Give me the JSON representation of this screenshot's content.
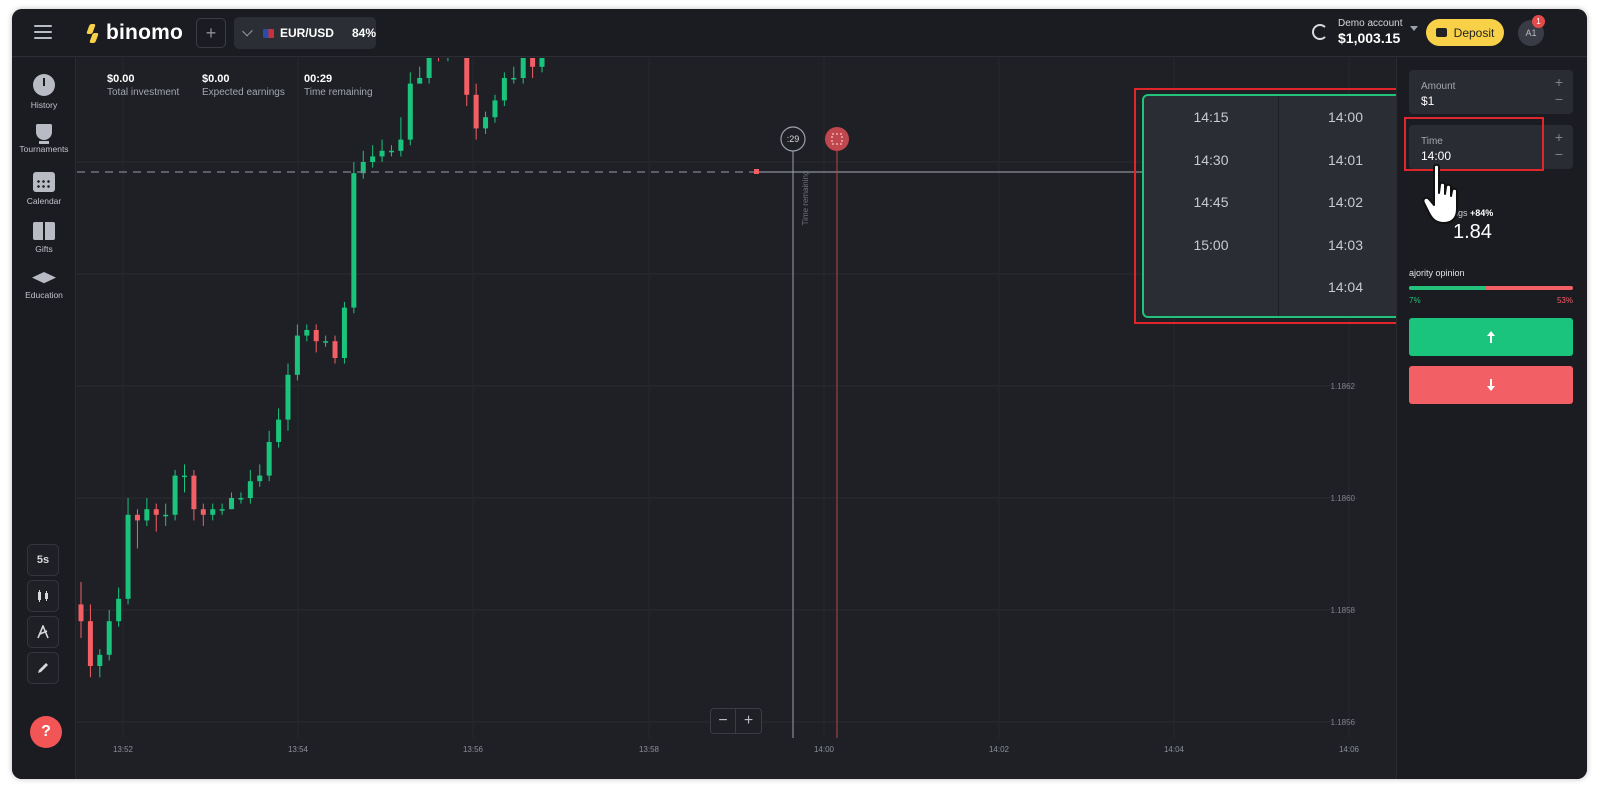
{
  "topbar": {
    "logo": "binomo",
    "asset": {
      "pair": "EUR/USD",
      "payout": "84%"
    },
    "account": {
      "name": "Demo account",
      "balance": "$1,003.15"
    },
    "deposit_label": "Deposit",
    "avatar": "A1",
    "notifications": "1"
  },
  "sidebar": {
    "items": [
      {
        "label": "History",
        "icon": "history-icon"
      },
      {
        "label": "Tournaments",
        "icon": "trophy-icon"
      },
      {
        "label": "Calendar",
        "icon": "calendar-icon"
      },
      {
        "label": "Gifts",
        "icon": "gift-icon"
      },
      {
        "label": "Education",
        "icon": "education-icon"
      }
    ],
    "tools": {
      "timeframe": "5s"
    },
    "help": "?"
  },
  "stats": {
    "total_investment": {
      "value": "$0.00",
      "label": "Total investment"
    },
    "expected_earnings": {
      "value": "$0.00",
      "label": "Expected earnings"
    },
    "time_remaining": {
      "value": "00:29",
      "label": "Time remaining"
    }
  },
  "chart_markers": {
    "countdown": ":29",
    "time_remaining_label": "Time remaining"
  },
  "chart_data": {
    "type": "candlestick",
    "x_ticks": [
      "13:52",
      "13:54",
      "13:56",
      "13:58",
      "14:00",
      "14:02",
      "14:04",
      "14:06"
    ],
    "y_ticks": [
      "1.1862",
      "1.1860",
      "1.1858",
      "1.1856"
    ],
    "ylim": [
      1.18556,
      1.18672
    ],
    "current_price": 1.18652,
    "candles": [
      [
        1.18581,
        1.18578,
        1.18585,
        1.18575
      ],
      [
        1.18578,
        1.1857,
        1.18581,
        1.18568
      ],
      [
        1.1857,
        1.18572,
        1.18573,
        1.18568
      ],
      [
        1.18572,
        1.18578,
        1.1858,
        1.18571
      ],
      [
        1.18578,
        1.18582,
        1.18584,
        1.18577
      ],
      [
        1.18582,
        1.18597,
        1.186,
        1.18581
      ],
      [
        1.18597,
        1.18596,
        1.18598,
        1.18591
      ],
      [
        1.18596,
        1.18598,
        1.186,
        1.18595
      ],
      [
        1.18598,
        1.18597,
        1.18599,
        1.18594
      ],
      [
        1.18597,
        1.18597,
        1.18599,
        1.18595
      ],
      [
        1.18597,
        1.18604,
        1.18605,
        1.18596
      ],
      [
        1.18604,
        1.18604,
        1.18606,
        1.18601
      ],
      [
        1.18604,
        1.18598,
        1.18605,
        1.18596
      ],
      [
        1.18598,
        1.18597,
        1.18599,
        1.18595
      ],
      [
        1.18597,
        1.18598,
        1.18599,
        1.18596
      ],
      [
        1.18598,
        1.18598,
        1.18599,
        1.18597
      ],
      [
        1.18598,
        1.186,
        1.18601,
        1.18598
      ],
      [
        1.186,
        1.186,
        1.18601,
        1.18599
      ],
      [
        1.186,
        1.18603,
        1.18605,
        1.18599
      ],
      [
        1.18603,
        1.18604,
        1.18606,
        1.18602
      ],
      [
        1.18604,
        1.1861,
        1.18612,
        1.18603
      ],
      [
        1.1861,
        1.18614,
        1.18616,
        1.18609
      ],
      [
        1.18614,
        1.18622,
        1.18624,
        1.18612
      ],
      [
        1.18622,
        1.18629,
        1.18631,
        1.18621
      ],
      [
        1.18629,
        1.1863,
        1.18631,
        1.18628
      ],
      [
        1.1863,
        1.18628,
        1.18631,
        1.18626
      ],
      [
        1.18628,
        1.18628,
        1.18629,
        1.18627
      ],
      [
        1.18628,
        1.18625,
        1.18629,
        1.18624
      ],
      [
        1.18625,
        1.18634,
        1.18635,
        1.18624
      ],
      [
        1.18634,
        1.18658,
        1.1866,
        1.18633
      ],
      [
        1.18658,
        1.1866,
        1.18662,
        1.18657
      ],
      [
        1.1866,
        1.18661,
        1.18663,
        1.18659
      ],
      [
        1.18661,
        1.18662,
        1.18664,
        1.1866
      ],
      [
        1.18662,
        1.18662,
        1.18663,
        1.18661
      ],
      [
        1.18662,
        1.18664,
        1.18668,
        1.18661
      ],
      [
        1.18664,
        1.18674,
        1.18676,
        1.18663
      ],
      [
        1.18674,
        1.18675,
        1.18677,
        1.18674
      ],
      [
        1.18675,
        1.18682,
        1.18684,
        1.18674
      ],
      [
        1.18682,
        1.18679,
        1.18683,
        1.18678
      ],
      [
        1.18679,
        1.18688,
        1.1869,
        1.18678
      ],
      [
        1.18688,
        1.18682,
        1.1869,
        1.18681
      ],
      [
        1.18682,
        1.18672,
        1.18683,
        1.1867
      ],
      [
        1.18672,
        1.18666,
        1.18674,
        1.18664
      ],
      [
        1.18666,
        1.18668,
        1.18669,
        1.18665
      ],
      [
        1.18668,
        1.18671,
        1.18672,
        1.18667
      ],
      [
        1.18671,
        1.18675,
        1.18676,
        1.1867
      ],
      [
        1.18675,
        1.18675,
        1.18677,
        1.18674
      ],
      [
        1.18675,
        1.1868,
        1.18681,
        1.18674
      ],
      [
        1.1868,
        1.18677,
        1.18681,
        1.18675
      ],
      [
        1.18677,
        1.1868,
        1.18681,
        1.18676
      ],
      [
        1.1868,
        1.18686,
        1.18688,
        1.18679
      ],
      [
        1.18686,
        1.18692,
        1.18694,
        1.18685
      ],
      [
        1.18692,
        1.187,
        1.18702,
        1.18691
      ],
      [
        1.187,
        1.18702,
        1.18703,
        1.18698
      ],
      [
        1.18702,
        1.1871,
        1.18712,
        1.18701
      ],
      [
        1.1871,
        1.18704,
        1.18713,
        1.18703
      ],
      [
        1.18704,
        1.18702,
        1.18705,
        1.18701
      ],
      [
        1.18702,
        1.18699,
        1.18703,
        1.18698
      ],
      [
        1.18699,
        1.18702,
        1.18703,
        1.18698
      ],
      [
        1.18702,
        1.18687,
        1.18703,
        1.18686
      ],
      [
        1.18687,
        1.18694,
        1.18696,
        1.18686
      ],
      [
        1.18694,
        1.18696,
        1.18697,
        1.18693
      ],
      [
        1.18696,
        1.18698,
        1.187,
        1.18695
      ],
      [
        1.18698,
        1.18697,
        1.18699,
        1.18696
      ],
      [
        1.18697,
        1.18697,
        1.18698,
        1.18695
      ],
      [
        1.18697,
        1.187,
        1.18701,
        1.18696
      ],
      [
        1.187,
        1.18699,
        1.18701,
        1.18698
      ],
      [
        1.18699,
        1.18697,
        1.187,
        1.18696
      ],
      [
        1.18697,
        1.187,
        1.18701,
        1.18697
      ],
      [
        1.187,
        1.18705,
        1.18706,
        1.18699
      ],
      [
        1.18705,
        1.18708,
        1.18709,
        1.18704
      ],
      [
        1.18708,
        1.18707,
        1.18709,
        1.18706
      ]
    ]
  },
  "time_dropdown": {
    "left": [
      "14:15",
      "14:30",
      "14:45",
      "15:00"
    ],
    "right": [
      "14:00",
      "14:01",
      "14:02",
      "14:03",
      "14:04"
    ]
  },
  "panel": {
    "amount": {
      "label": "Amount",
      "value": "$1"
    },
    "time": {
      "label": "Time",
      "value": "14:00"
    },
    "earnings": {
      "label": "ngs",
      "pct": "+84%",
      "value": "1.84"
    },
    "majority": {
      "label": "ajority opinion",
      "up_pct": "7%",
      "down_pct": "53%",
      "up_share": 0.47
    }
  },
  "colors": {
    "up": "#1bc47d",
    "down": "#f25f65",
    "accent": "#f8d148",
    "bg": "#1f2026"
  }
}
